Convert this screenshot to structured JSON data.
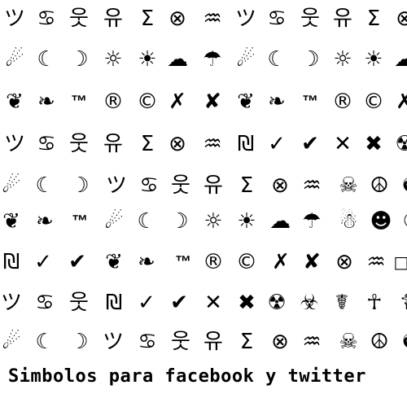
{
  "rows": [
    [
      "ツ",
      "♋",
      "웃",
      "유",
      "Σ",
      "⊗",
      "♒",
      "ツ",
      "♋",
      "웃",
      "유",
      "Σ",
      "⊗"
    ],
    [
      "☄",
      "☾",
      "☽",
      "☼",
      "☀",
      "☁",
      "☂",
      "☄",
      "☾",
      "☽",
      "☼",
      "☀",
      "☁"
    ],
    [
      "❦",
      "❧",
      "™",
      "®",
      "©",
      "✗",
      "✘",
      "❦",
      "❧",
      "™",
      "®",
      "©",
      "✗"
    ],
    [
      "ツ",
      "♋",
      "웃",
      "유",
      "Σ",
      "⊗",
      "♒",
      "₪",
      "✓",
      "✔",
      "✕",
      "✖",
      "☢"
    ],
    [
      "☄",
      "☾",
      "☽",
      "ツ",
      "♋",
      "웃",
      "유",
      "Σ",
      "⊗",
      "♒",
      "☠",
      "☮",
      "☯"
    ],
    [
      "❦",
      "❧",
      "™",
      "☄",
      "☾",
      "☽",
      "☼",
      "☀",
      "☁",
      "☂",
      "☃",
      "☻",
      "☾"
    ],
    [
      "₪",
      "✓",
      "✔",
      "❦",
      "❧",
      "™",
      "®",
      "©",
      "✗",
      "✘",
      "⊗",
      "♒",
      "□"
    ],
    [
      "ツ",
      "♋",
      "웃",
      "₪",
      "✓",
      "✔",
      "✕",
      "✖",
      "☢",
      "☣",
      "☤",
      "☥",
      "☦"
    ],
    [
      "☄",
      "☾",
      "☽",
      "ツ",
      "♋",
      "웃",
      "유",
      "Σ",
      "⊗",
      "♒",
      "☠",
      "☮",
      "☯"
    ]
  ],
  "row_names": [
    [
      "tsu",
      "cancer",
      "person-hangul",
      "yu-hangul",
      "sigma",
      "circled-times",
      "aquarius",
      "tsu",
      "cancer",
      "person-hangul",
      "yu-hangul",
      "sigma",
      "circled-times"
    ],
    [
      "comet",
      "moon-left",
      "moon-right",
      "sun-outline",
      "sun-filled",
      "cloud",
      "umbrella",
      "comet",
      "moon-left",
      "moon-right",
      "sun-outline",
      "sun-filled",
      "cloud"
    ],
    [
      "floral-heart",
      "rotated-floral-heart",
      "trademark",
      "registered",
      "copyright",
      "ballot-x",
      "heavy-ballot-x",
      "floral-heart",
      "rotated-floral-heart",
      "trademark",
      "registered",
      "copyright",
      "ballot-x"
    ],
    [
      "tsu",
      "cancer",
      "person-hangul",
      "yu-hangul",
      "sigma",
      "circled-times",
      "aquarius",
      "shekel",
      "check",
      "heavy-check",
      "multiplication-x",
      "heavy-multiplication-x",
      "radioactive"
    ],
    [
      "comet",
      "moon-left",
      "moon-right",
      "tsu",
      "cancer",
      "person-hangul",
      "yu-hangul",
      "sigma",
      "circled-times",
      "aquarius",
      "skull-crossbones",
      "peace",
      "yin-yang"
    ],
    [
      "floral-heart",
      "rotated-floral-heart",
      "trademark",
      "comet",
      "moon-left",
      "moon-right",
      "sun-outline",
      "sun-filled",
      "cloud",
      "umbrella",
      "snowman",
      "smiley",
      "moon-left"
    ],
    [
      "shekel",
      "check",
      "heavy-check",
      "floral-heart",
      "rotated-floral-heart",
      "trademark",
      "registered",
      "copyright",
      "ballot-x",
      "heavy-ballot-x",
      "circled-times",
      "aquarius",
      "white-square"
    ],
    [
      "tsu",
      "cancer",
      "person-hangul",
      "shekel",
      "check",
      "heavy-check",
      "multiplication-x",
      "heavy-multiplication-x",
      "radioactive",
      "biohazard",
      "caduceus",
      "ankh",
      "orthodox-cross"
    ],
    [
      "comet",
      "moon-left",
      "moon-right",
      "tsu",
      "cancer",
      "person-hangul",
      "yu-hangul",
      "sigma",
      "circled-times",
      "aquarius",
      "skull-crossbones",
      "peace",
      "yin-yang"
    ]
  ],
  "caption": "Simbolos para facebook y twitter"
}
